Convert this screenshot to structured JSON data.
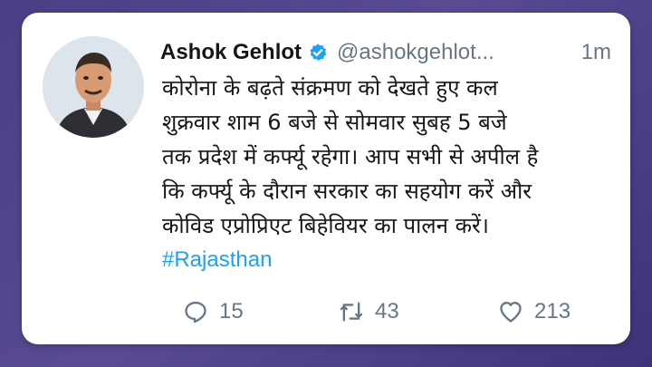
{
  "tweet": {
    "author_name": "Ashok Gehlot",
    "handle": "@ashokgehlot...",
    "time": "1m",
    "text_lines": [
      "कोरोना के बढ़ते संक्रमण को देखते हुए कल",
      "शुक्रवार शाम 6 बजे से सोमवार सुबह 5 बजे",
      "तक प्रदेश में कर्फ्यू रहेगा। आप सभी से अपील है",
      "कि कर्फ्यू के दौरान सरकार का सहयोग करें और",
      "कोविड एप्रोप्रिएट बिहेवियर का पालन करें।"
    ],
    "hashtag": "#Rajasthan",
    "replies": "15",
    "retweets": "43",
    "likes": "213"
  },
  "colors": {
    "background": "#4a3f86",
    "card": "#ffffff",
    "accent": "#1da1f2",
    "muted": "#657786"
  },
  "icons": {
    "verified": "verified-badge-icon",
    "reply": "reply-icon",
    "retweet": "retweet-icon",
    "like": "heart-icon"
  }
}
